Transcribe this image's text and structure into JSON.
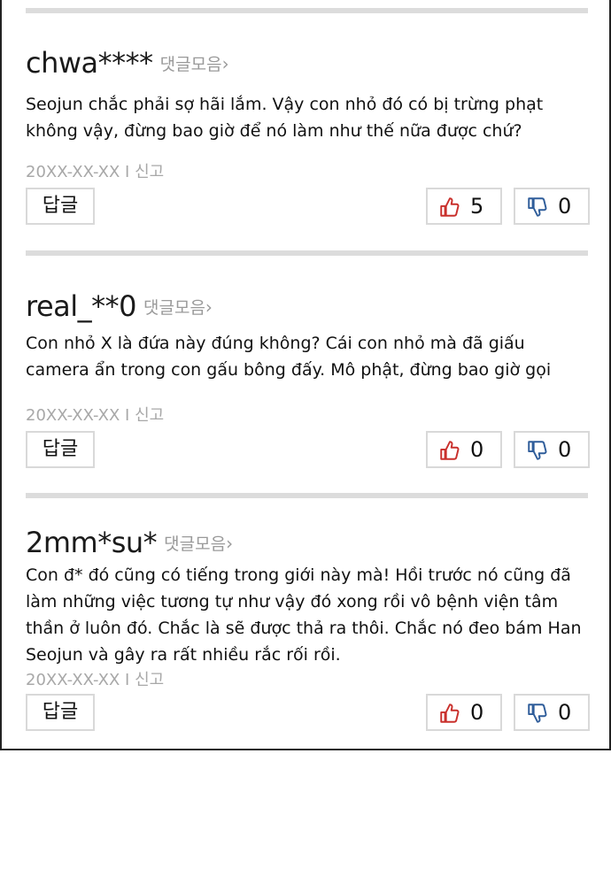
{
  "comments": [
    {
      "username": "chwa****",
      "collect_label": "댓글모음",
      "chevron": "›",
      "text": "Seojun chắc phải sợ hãi lắm. Vậy con nhỏ đó có bị trừng phạt không vậy, đừng bao giờ để nó làm như thế nữa được chứ?",
      "date": "20XX-XX-XX",
      "sep": "I",
      "report": "신고",
      "reply_label": "답글",
      "likes": "5",
      "dislikes": "0"
    },
    {
      "username": "real_**0",
      "collect_label": "댓글모음",
      "chevron": "›",
      "text": "Con nhỏ X là đứa này đúng không? Cái con nhỏ mà đã giấu camera ẩn trong con gấu bông đấy. Mô phật, đừng bao giờ gọi",
      "date": "20XX-XX-XX",
      "sep": "I",
      "report": "신고",
      "reply_label": "답글",
      "likes": "0",
      "dislikes": "0"
    },
    {
      "username": "2mm*su*",
      "collect_label": "댓글모음",
      "chevron": "›",
      "text": "Con đ* đó cũng có tiếng trong giới này mà! Hồi trước nó cũng đã làm những việc tương tự như vậy đó xong rồi vô bệnh viện tâm thần ở luôn đó. Chắc là sẽ được thả ra thôi. Chắc nó đeo bám Han Seojun và gây ra rất nhiều rắc rối rồi.",
      "date": "20XX-XX-XX",
      "sep": "I",
      "report": "신고",
      "reply_label": "답글",
      "likes": "0",
      "dislikes": "0"
    }
  ],
  "colors": {
    "like_red": "#c9302c",
    "dislike_blue": "#2f5d9a",
    "muted": "#9a9a9a"
  },
  "icons": {
    "like": "thumbs-up-icon",
    "dislike": "thumbs-down-icon"
  }
}
